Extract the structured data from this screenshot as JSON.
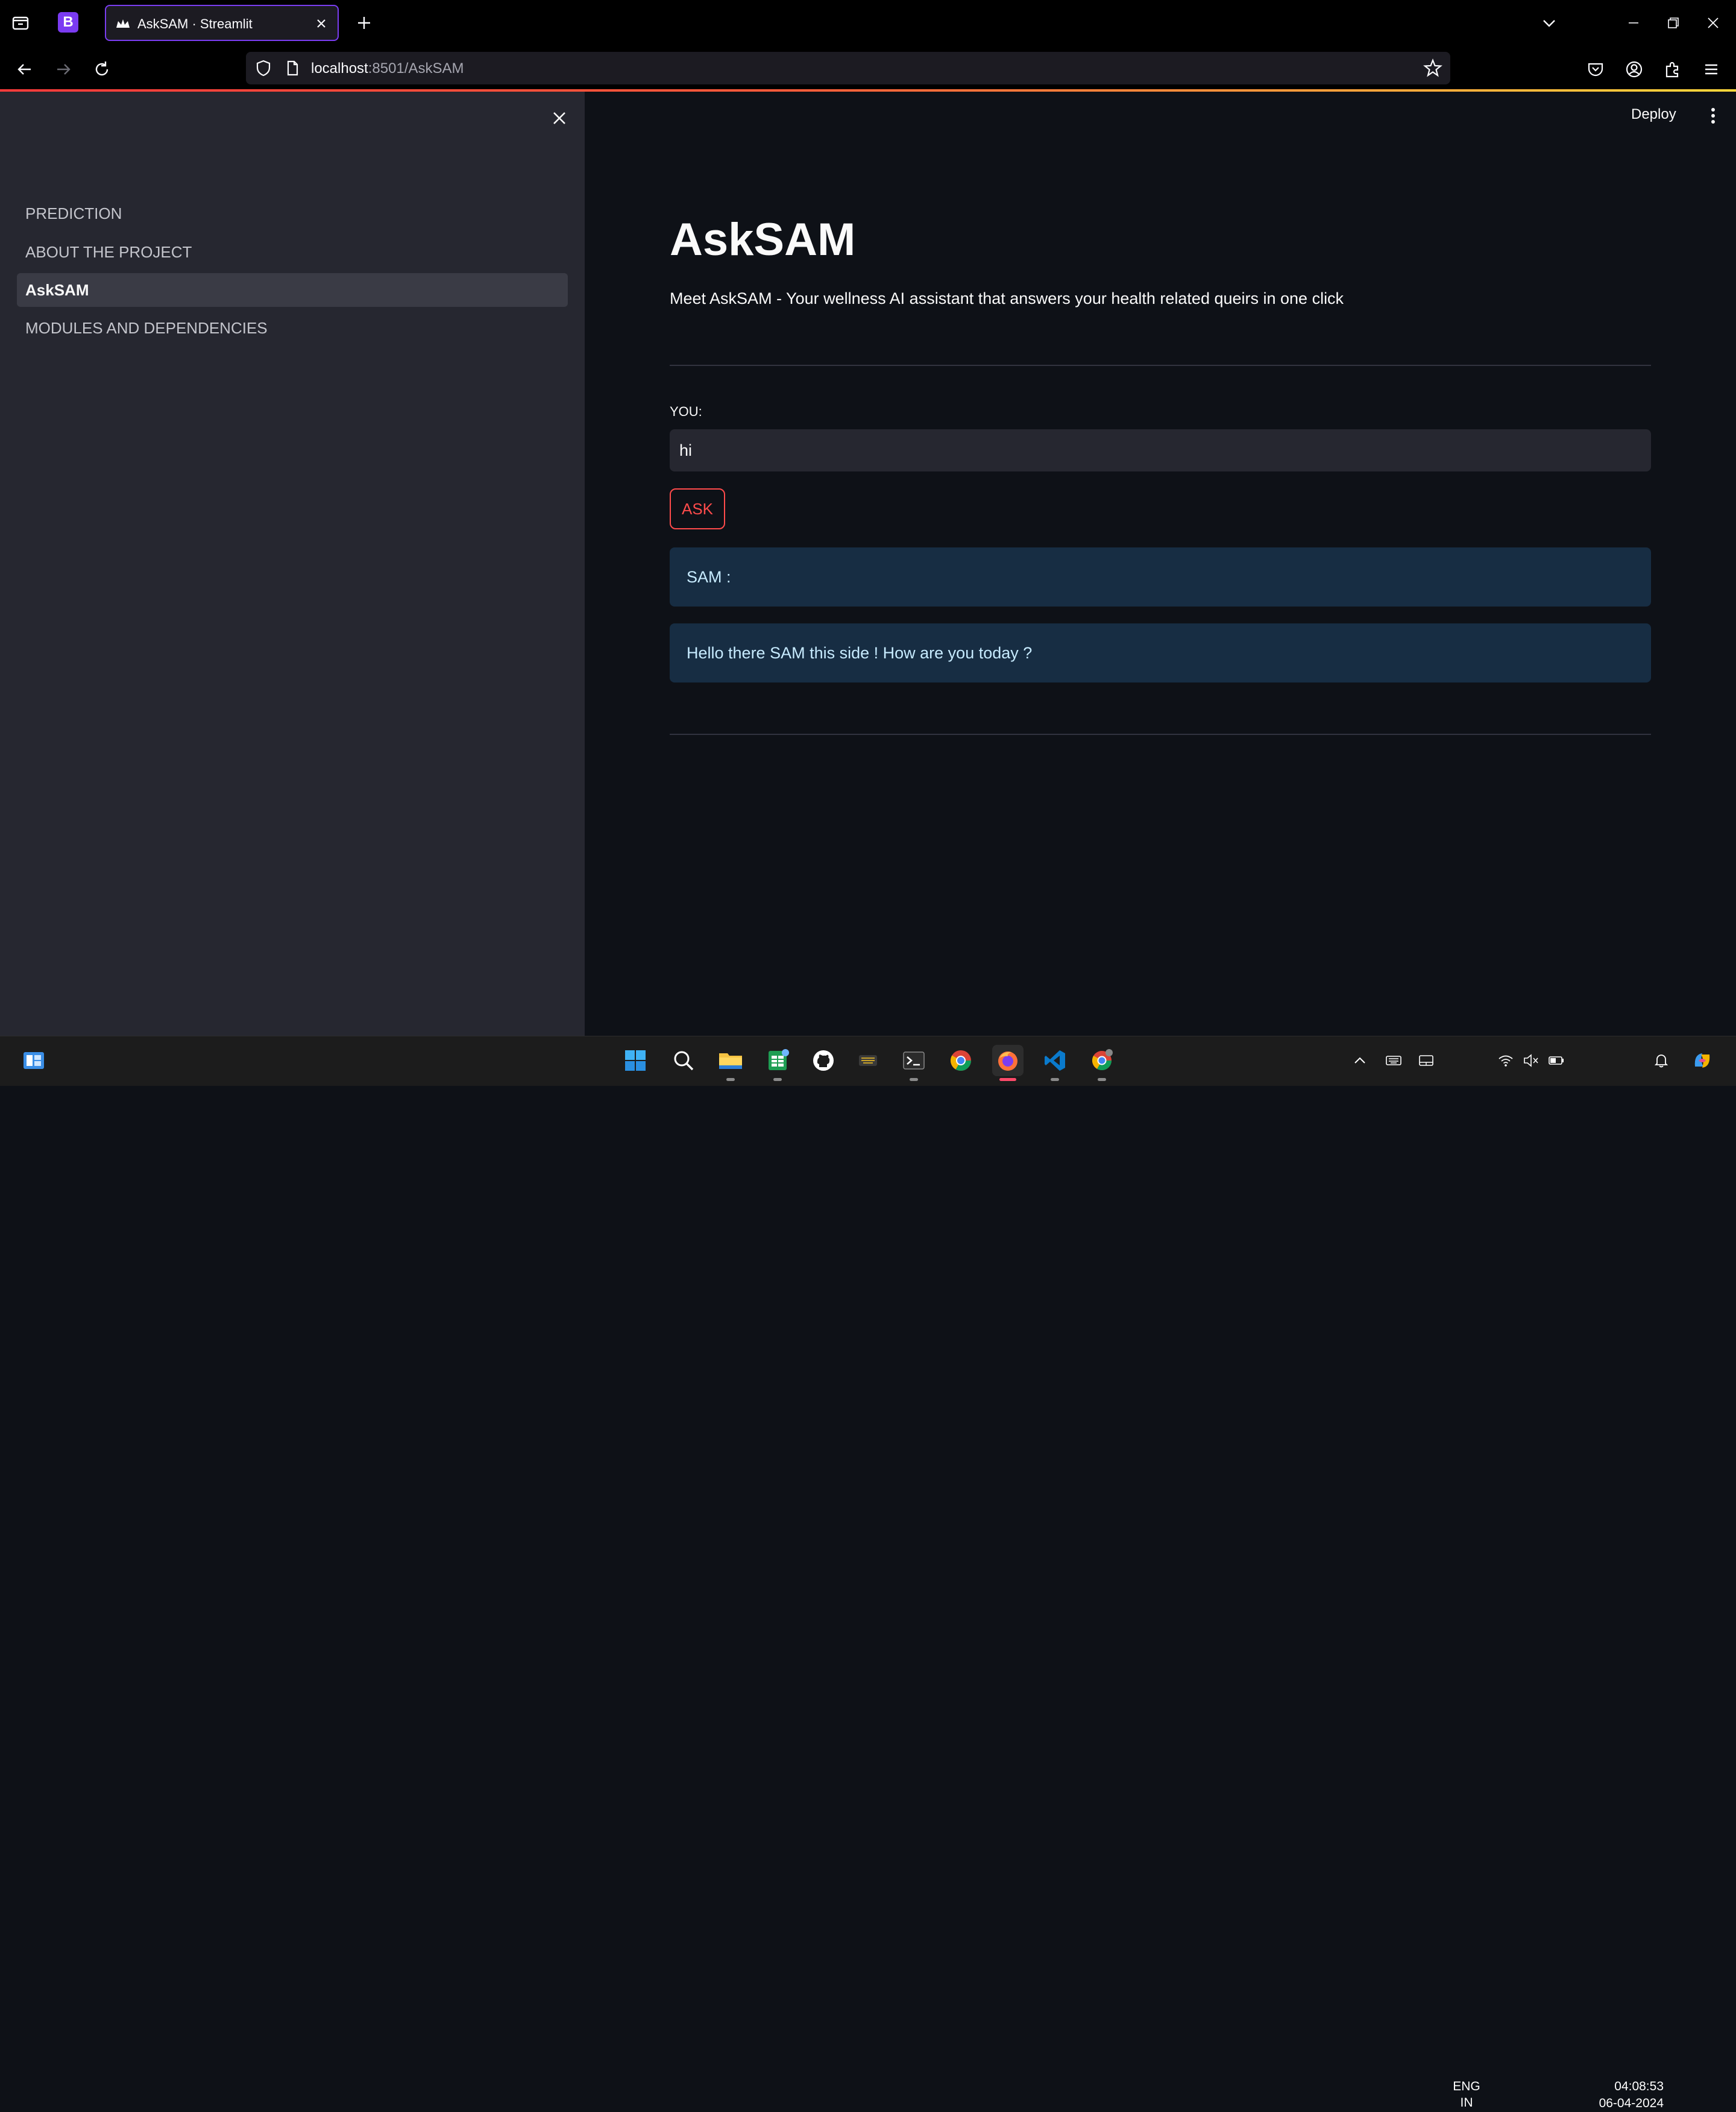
{
  "browser": {
    "pinned_tab_letter": "B",
    "tab_title": "AskSAM · Streamlit",
    "url_host": "localhost",
    "url_rest": ":8501/AskSAM",
    "progress_color": "#ff4b4b"
  },
  "app": {
    "deploy_label": "Deploy",
    "sidebar": {
      "items": [
        {
          "label": "PREDICTION",
          "active": false
        },
        {
          "label": "ABOUT THE PROJECT",
          "active": false
        },
        {
          "label": "AskSAM",
          "active": true
        },
        {
          "label": "MODULES AND DEPENDENCIES",
          "active": false
        }
      ]
    },
    "title": "AskSAM",
    "subtitle": "Meet AskSAM - Your wellness AI assistant that answers your health related queirs in one click",
    "input_label": "YOU:",
    "input_value": "hi",
    "ask_button": "ASK",
    "responses": [
      "SAM :",
      "Hello there SAM this side ! How are you today ?"
    ],
    "accent_color": "#ff4b4b",
    "info_bg": "#172d43"
  },
  "taskbar": {
    "language": "ENG",
    "region": "IN",
    "time": "04:08:53",
    "date": "06-04-2024",
    "apps": [
      "widgets",
      "start",
      "search",
      "file-explorer",
      "sheets-app",
      "github-desktop",
      "keyboard-app",
      "terminal",
      "chrome",
      "firefox",
      "vscode",
      "chrome-profile"
    ]
  }
}
